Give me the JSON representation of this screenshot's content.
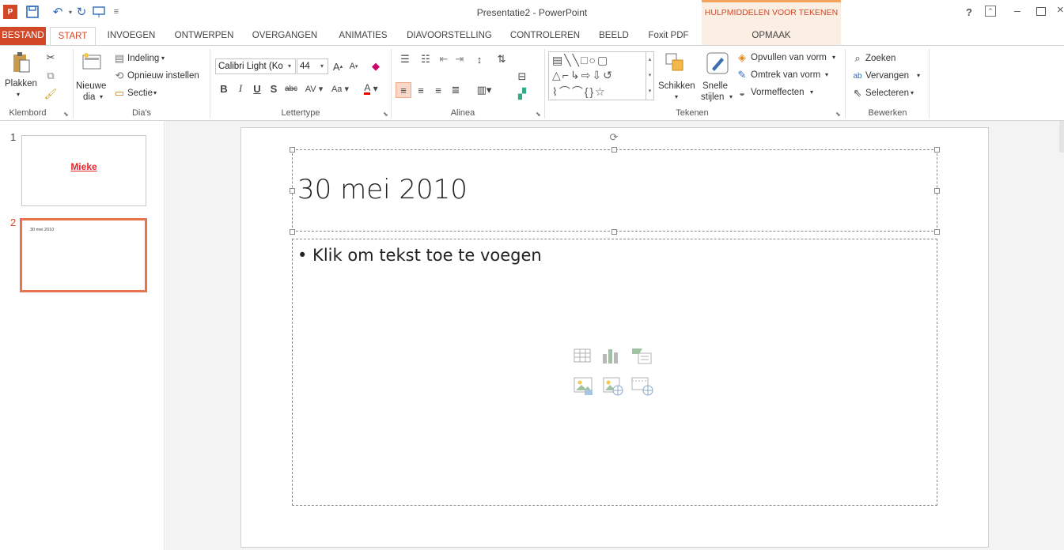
{
  "window": {
    "title": "Presentatie2 - PowerPoint",
    "context_header": "HULPMIDDELEN VOOR TEKENEN",
    "controls": {
      "help": "?",
      "restore_ribbon": "⊼",
      "minimize": "–",
      "maximize": "□",
      "close": "×"
    }
  },
  "tabs": {
    "file": "BESTAND",
    "start": "START",
    "invoegen": "INVOEGEN",
    "ontwerpen": "ONTWERPEN",
    "overgangen": "OVERGANGEN",
    "animaties": "ANIMATIES",
    "diavoorstelling": "DIAVOORSTELLING",
    "controleren": "CONTROLEREN",
    "beeld": "BEELD",
    "foxit": "Foxit PDF",
    "opmaak": "OPMAAK"
  },
  "ribbon": {
    "klembord": {
      "label": "Klembord",
      "plakken": "Plakken"
    },
    "dias": {
      "label": "Dia's",
      "nieuwe_1": "Nieuwe",
      "nieuwe_2": "dia",
      "indeling": "Indeling",
      "opnieuw": "Opnieuw instellen",
      "sectie": "Sectie"
    },
    "lettertype": {
      "label": "Lettertype",
      "font": "Calibri Light (Ko",
      "size": "44"
    },
    "alinea": {
      "label": "Alinea"
    },
    "tekenen": {
      "label": "Tekenen",
      "schikken": "Schikken",
      "snelle_1": "Snelle",
      "snelle_2": "stijlen",
      "opvullen": "Opvullen van vorm",
      "omtrek": "Omtrek van vorm",
      "vormeffecten": "Vormeffecten"
    },
    "bewerken": {
      "label": "Bewerken",
      "zoeken": "Zoeken",
      "vervangen": "Vervangen",
      "selecteren": "Selecteren"
    }
  },
  "thumbnails": [
    {
      "number": "1",
      "title": "Mieke"
    },
    {
      "number": "2",
      "title": "30 mei 2010"
    }
  ],
  "slide": {
    "title": "30 mei 2010",
    "content_placeholder": "• Klik om tekst toe te voegen"
  },
  "colors": {
    "accent": "#d24726",
    "selected_thumb": "#e8734f",
    "context_tab": "#fbeee2"
  }
}
